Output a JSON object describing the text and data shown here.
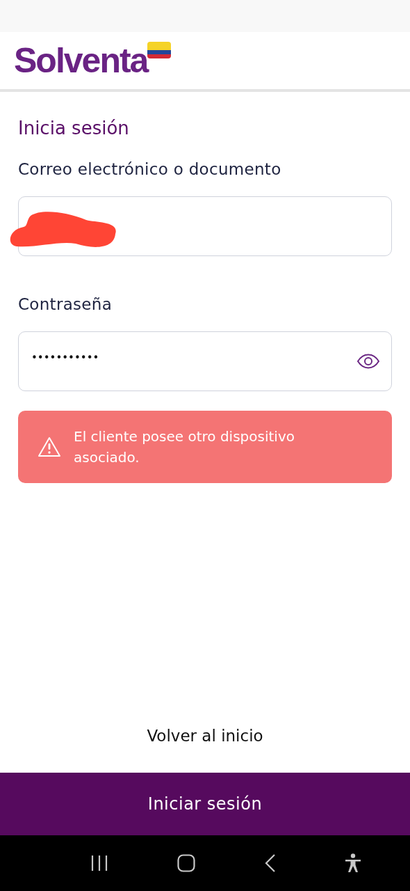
{
  "header": {
    "logo": "Solventa"
  },
  "title": "Inicia sesión",
  "fields": [
    {
      "kind": "text",
      "label": "Correo electrónico o documento",
      "redacted": true
    },
    {
      "kind": "password",
      "label": "Contraseña",
      "value": "•••••••••••",
      "redacted": false
    }
  ],
  "error": {
    "message": "El cliente posee otro dispositivo asociado."
  },
  "back_link": "Volver al inicio",
  "submit_button": "Iniciar sesión"
}
